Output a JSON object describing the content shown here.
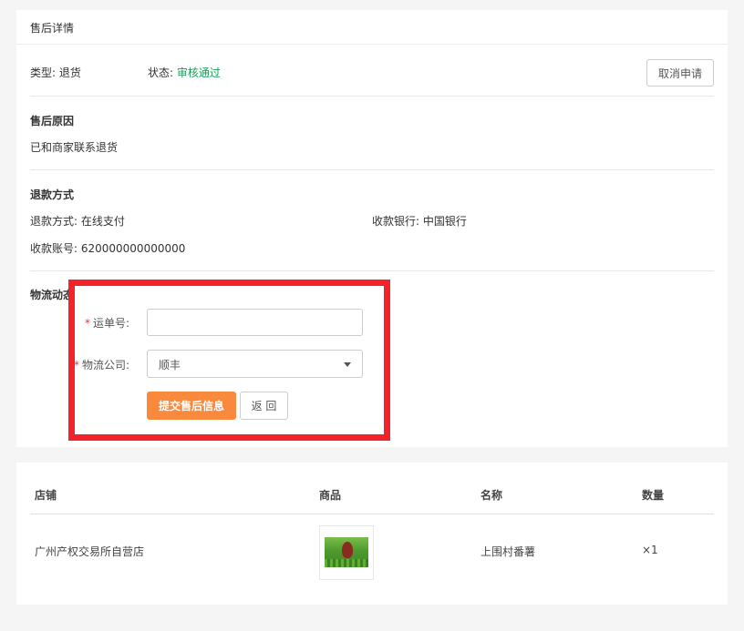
{
  "detail": {
    "title": "售后详情",
    "type_text": "类型: 退货",
    "status_label": "状态: ",
    "status_value": "审核通过",
    "cancel_button": "取消申请"
  },
  "reason": {
    "heading": "售后原因",
    "text": "已和商家联系退货"
  },
  "refund": {
    "heading": "退款方式",
    "method": "退款方式: 在线支付",
    "bank": "收款银行: 中国银行",
    "account": "收款账号: 620000000000000"
  },
  "logistics": {
    "heading": "物流动态",
    "required_mark": "*",
    "tracking_label": "运单号:",
    "tracking_value": "",
    "company_label": "物流公司:",
    "company_value": "顺丰",
    "submit_button": "提交售后信息",
    "back_button": "返 回"
  },
  "highlight_color": "#f2232a",
  "accent_color": "#f9893c",
  "status_color": "#1c9d5b",
  "table": {
    "headers": [
      "店铺",
      "商品",
      "名称",
      "数量"
    ],
    "rows": [
      {
        "shop": "广州产权交易所自营店",
        "product_image": "crop-thumbnail",
        "name": "上围村番薯",
        "quantity": "×1"
      }
    ]
  },
  "icons": {
    "select_caret": "caret-down-icon"
  }
}
